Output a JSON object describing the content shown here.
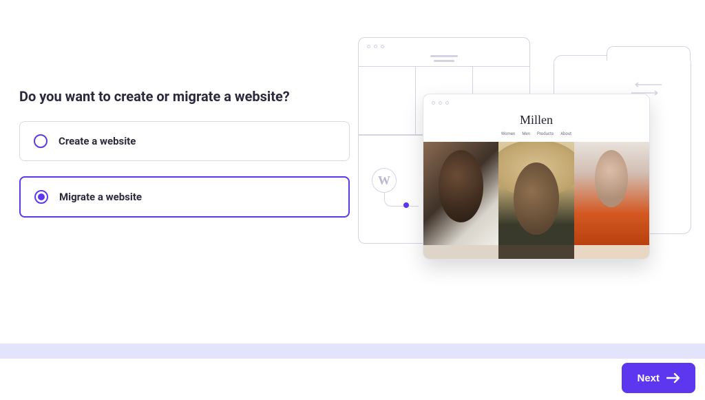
{
  "question": "Do you want to create or migrate a website?",
  "options": {
    "create": {
      "label": "Create a website",
      "selected": false
    },
    "migrate": {
      "label": "Migrate a website",
      "selected": true
    }
  },
  "preview": {
    "site_title": "Millen",
    "nav_items": [
      "Women",
      "Men",
      "Products",
      "About"
    ]
  },
  "actions": {
    "next_label": "Next"
  },
  "colors": {
    "accent": "#5d37ef"
  }
}
